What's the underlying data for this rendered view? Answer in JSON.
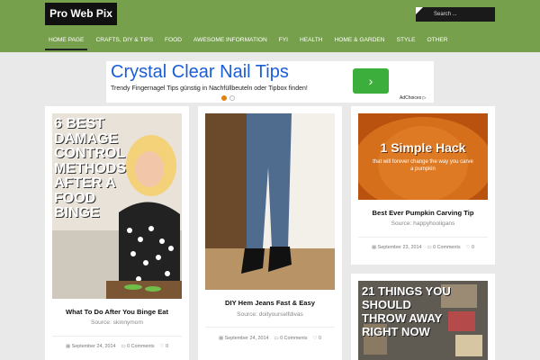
{
  "site": {
    "logo": "Pro Web Pix",
    "search_placeholder": "Search ..."
  },
  "nav": [
    "HOME PAGE",
    "CRAFTS, DIY & TIPS",
    "FOOD",
    "AWESOME INFORMATION",
    "FYI",
    "HEALTH",
    "HOME & GARDEN",
    "STYLE",
    "OTHER"
  ],
  "ad": {
    "title": "Crystal Clear Nail Tips",
    "text": "Trendy Fingernagel Tips günstig in Nachfüllbeuteln oder Tipbox finden!",
    "button": "›",
    "choices": "AdChoices ▷"
  },
  "cards": [
    {
      "image_text": "6 BEST DAMAGE CONTROL METHODS AFTER A FOOD BINGE",
      "title": "What To Do After You Binge Eat",
      "source": "Source: skinnymom",
      "date": "September 24, 2014",
      "comments": "0 Comments",
      "likes": "0"
    },
    {
      "image_text": "",
      "title": "DIY Hem Jeans Fast & Easy",
      "source": "Source: doityourselfdivas",
      "date": "September 24, 2014",
      "comments": "0 Comments",
      "likes": "0"
    },
    {
      "image_text": "1 Simple Hack",
      "image_sub": "that will forever change the way you carve a pumpkin",
      "title": "Best Ever Pumpkin Carving Tip",
      "source": "Source: happyhooligans",
      "date": "September 23, 2014",
      "comments": "0 Comments",
      "likes": "0"
    },
    {
      "image_text": "21 THINGS YOU SHOULD THROW AWAY RIGHT NOW"
    }
  ],
  "colors": {
    "header": "#77a04c",
    "ad_title": "#1a5dd6",
    "ad_button": "#3cae3c",
    "dot_active": "#e2820f"
  }
}
